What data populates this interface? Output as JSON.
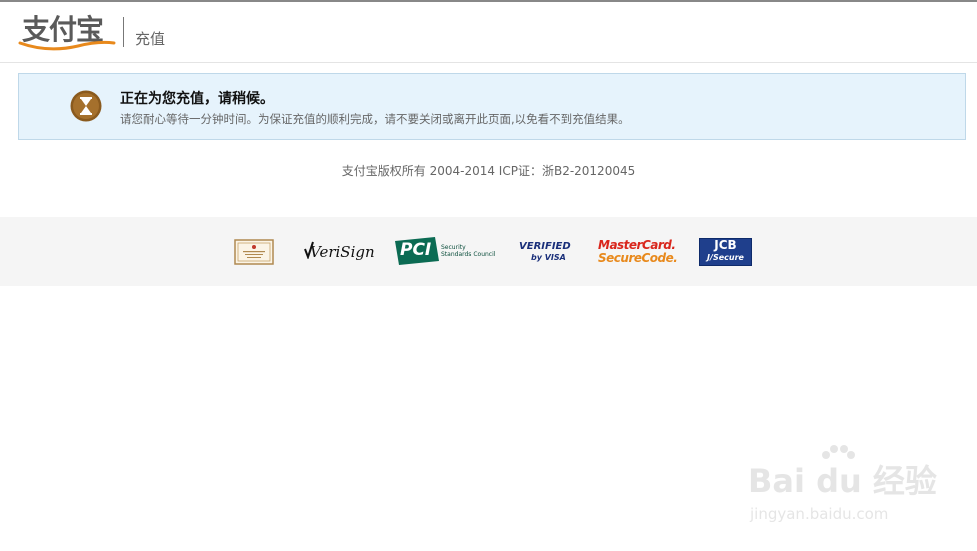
{
  "header": {
    "logo_text": "支付宝",
    "title": "充值"
  },
  "notice": {
    "icon": "hourglass-icon",
    "title": "正在为您充值，请稍候。",
    "subtitle": "请您耐心等待一分钟时间。为保证充值的顺利完成，请不要关闭或离开此页面,以免看不到充值结果。"
  },
  "footer": {
    "copyright": "支付宝版权所有  2004-2014 ICP证：浙B2-20120045",
    "badges": {
      "verisign": "VeriSign",
      "pci_main": "PCI",
      "pci_sub1": "Security",
      "pci_sub2": "Standards Council",
      "visa_1": "VERIFIED",
      "visa_2": "by VISA",
      "mc_1": "MasterCard.",
      "mc_2": "SecureCode.",
      "jcb_1": "JCB",
      "jcb_2": "J/Secure"
    }
  },
  "watermark": {
    "main": "Bai du 经验",
    "sub": "jingyan.baidu.com"
  },
  "colors": {
    "notice_bg": "#e6f3fc",
    "notice_border": "#bfd8e9",
    "logo_orange": "#e8891c",
    "icon_brown": "#8a5a1e"
  }
}
